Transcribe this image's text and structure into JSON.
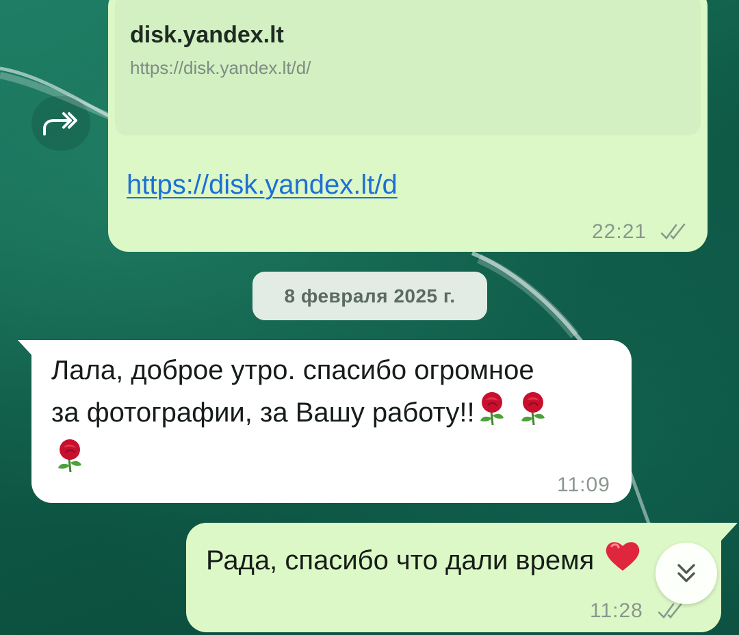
{
  "link_message": {
    "preview_title": "disk.yandex.lt",
    "preview_url": "https://disk.yandex.lt/d/",
    "link": "https://disk.yandex.lt/d",
    "time": "22:21",
    "status": "read"
  },
  "date_separator": "8 февраля 2025 г.",
  "incoming_message": {
    "text_line1": "Лала, доброе утро. спасибо огромное",
    "text_line2": "за фотографии, за Вашу работу!!",
    "emojis": [
      "rose",
      "rose",
      "rose"
    ],
    "time": "11:09"
  },
  "outgoing_message": {
    "text": "Рада, спасибо что дали время",
    "emoji": "heart",
    "time": "11:28",
    "status": "read"
  },
  "icons": {
    "forward": "forward-icon",
    "scroll_down": "chevron-double-down-icon",
    "read_ticks": "double-check-icon"
  },
  "colors": {
    "outgoing_bubble": "#dcf8c6",
    "incoming_bubble": "#ffffff",
    "link": "#1d6fd4",
    "wallpaper": "#0f5a47"
  }
}
